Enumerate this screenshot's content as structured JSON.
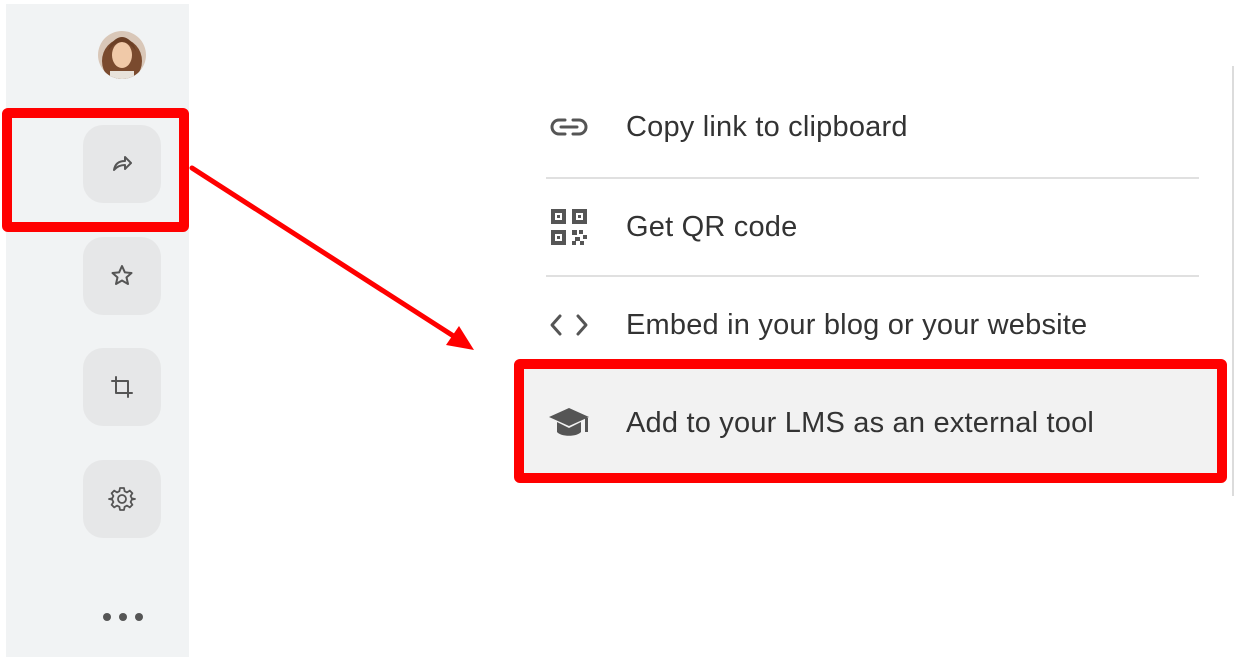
{
  "sidebar": {
    "avatar": "user-avatar",
    "buttons": [
      {
        "name": "share",
        "icon": "share-arrow-icon"
      },
      {
        "name": "favorite",
        "icon": "star-icon"
      },
      {
        "name": "crop",
        "icon": "crop-icon"
      },
      {
        "name": "settings",
        "icon": "gear-icon"
      }
    ],
    "more_icon": "more-dots-icon"
  },
  "share_menu": {
    "items": [
      {
        "label": "Copy link to clipboard",
        "icon": "link-icon"
      },
      {
        "label": "Get QR code",
        "icon": "qr-code-icon"
      },
      {
        "label": "Embed in your blog or your website",
        "icon": "code-brackets-icon"
      },
      {
        "label": "Add to your LMS as an external tool",
        "icon": "graduation-cap-icon"
      }
    ]
  },
  "colors": {
    "annotation": "#ff0000",
    "sidebar_bg": "#f1f3f4",
    "button_bg": "#e6e7e8",
    "text": "#333333"
  }
}
